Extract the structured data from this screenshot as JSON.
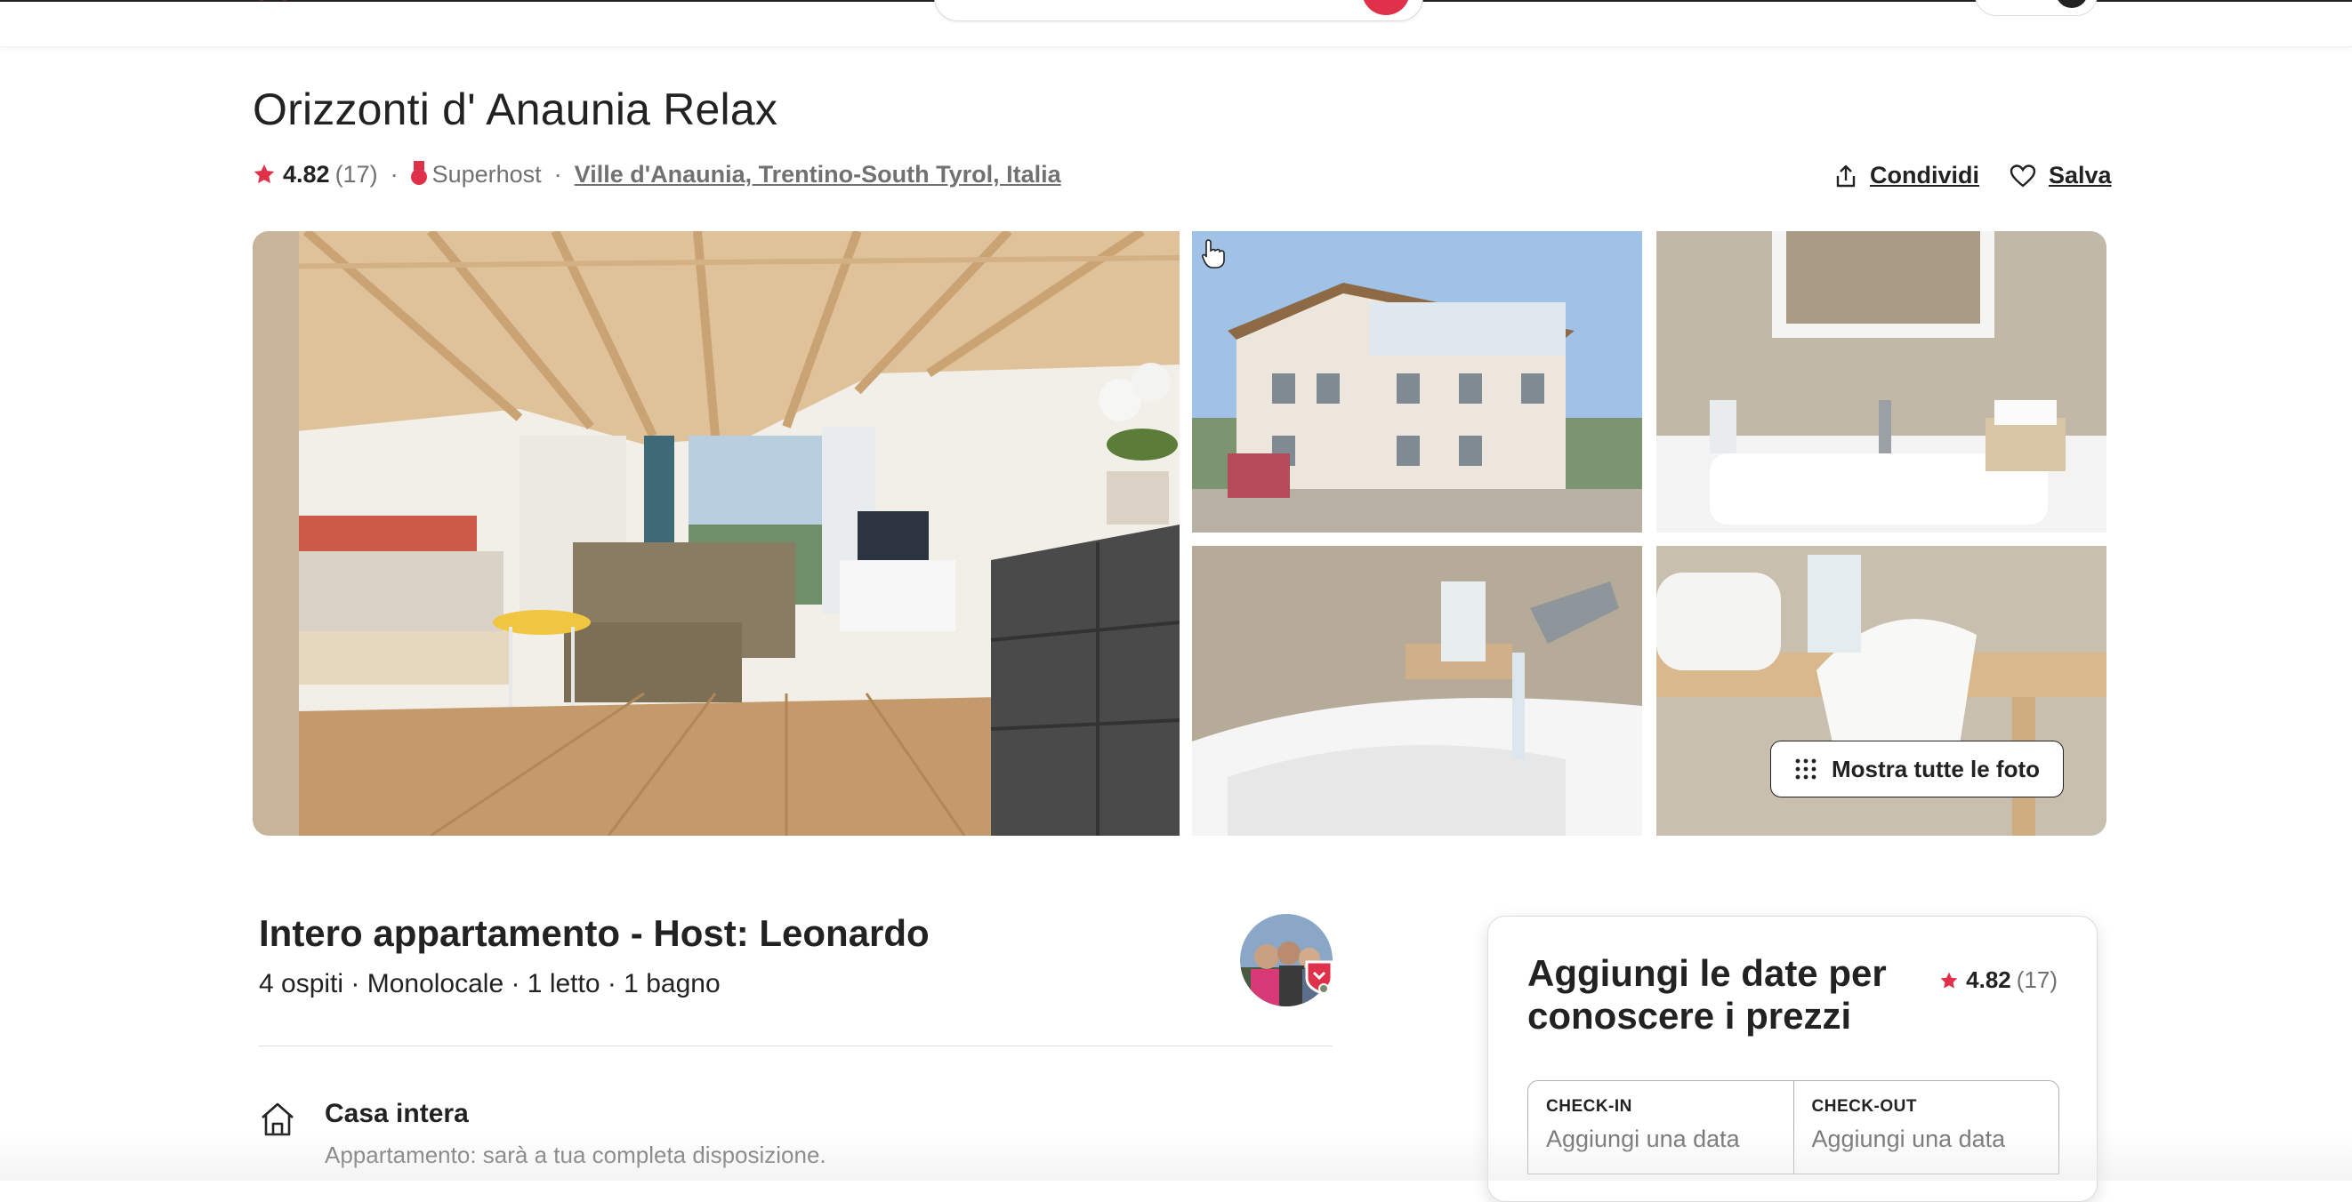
{
  "listing": {
    "title": "Orizzonti d' Anaunia Relax",
    "rating": "4.82",
    "reviews_count": "(17)",
    "separator": "·",
    "superhost": "Superhost",
    "location": "Ville d'Anaunia, Trentino-South Tyrol, Italia"
  },
  "actions": {
    "share": "Condividi",
    "save": "Salva"
  },
  "gallery": {
    "show_all": "Mostra tutte le foto"
  },
  "host": {
    "title": "Intero appartamento - Host: Leonardo",
    "summary": "4 ospiti · Monolocale · 1 letto · 1 bagno"
  },
  "feature": {
    "icon": "home-icon",
    "title": "Casa intera",
    "description": "Appartamento: sarà a tua completa disposizione."
  },
  "booking": {
    "title": "Aggiungi le date per conoscere i prezzi",
    "rating": "4.82",
    "reviews_count": "(17)",
    "checkin_label": "CHECK-IN",
    "checkin_value": "Aggiungi una data",
    "checkout_label": "CHECK-OUT",
    "checkout_value": "Aggiungi una data"
  },
  "colors": {
    "brand": "#e0314a",
    "text": "#222222",
    "muted": "#717171",
    "border": "#dddddd"
  }
}
